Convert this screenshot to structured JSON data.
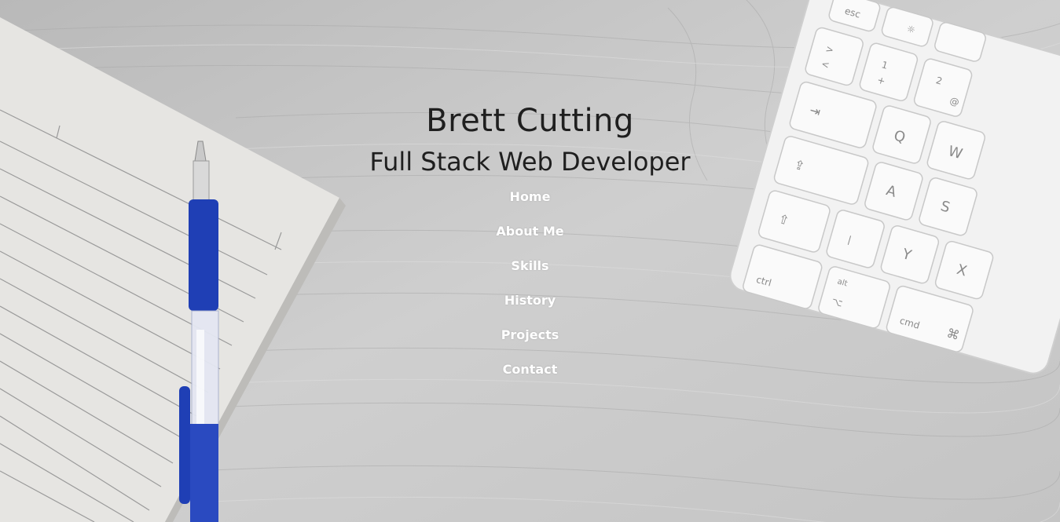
{
  "header": {
    "name": "Brett Cutting",
    "role": "Full Stack Web Developer"
  },
  "nav": {
    "items": [
      {
        "label": "Home"
      },
      {
        "label": "About Me"
      },
      {
        "label": "Skills"
      },
      {
        "label": "History"
      },
      {
        "label": "Projects"
      },
      {
        "label": "Contact"
      }
    ]
  },
  "background": {
    "description_icons": [
      "notebook-image",
      "pen-image",
      "keyboard-image"
    ],
    "keyboard_keys": [
      "esc",
      ">",
      "<",
      "1",
      "+",
      "2",
      "@",
      "Q",
      "W",
      "A",
      "S",
      "Y",
      "X",
      "ctrl",
      "alt",
      "cmd",
      "⌘"
    ],
    "colors": {
      "wood": "#c9c9c9",
      "pen_blue": "#1f3fb5",
      "paper": "#e8e7e4",
      "keyboard": "#f0f0f0"
    }
  }
}
